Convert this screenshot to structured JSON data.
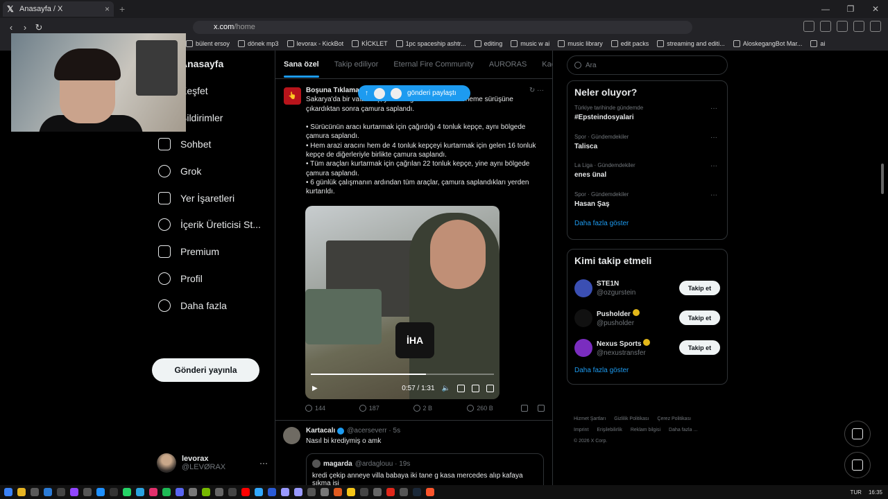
{
  "browser": {
    "tab_title": "Anasayfa / X",
    "url_host": "x.com",
    "url_path": "/home",
    "bookmarks": [
      "bülent ersoy",
      "dönek mp3",
      "levorax - KickBot",
      "KİCKLET",
      "1pc spaceship ashtr...",
      "editing",
      "music w ai",
      "music library",
      "edit packs",
      "streaming and editi...",
      "AloskegangBot Mar...",
      "ai"
    ]
  },
  "nav": {
    "items": [
      {
        "label": "Anasayfa",
        "icon": "home-icon"
      },
      {
        "label": "Keşfet",
        "icon": "search-icon"
      },
      {
        "label": "Bildirimler",
        "icon": "bell-icon"
      },
      {
        "label": "Sohbet",
        "icon": "mail-icon"
      },
      {
        "label": "Grok",
        "icon": "grok-icon"
      },
      {
        "label": "Yer İşaretleri",
        "icon": "bookmark-icon"
      },
      {
        "label": "İçerik Üreticisi St...",
        "icon": "creator-icon"
      },
      {
        "label": "Premium",
        "icon": "x-logo-icon"
      },
      {
        "label": "Profil",
        "icon": "person-icon"
      },
      {
        "label": "Daha fazla",
        "icon": "more-circle-icon"
      }
    ],
    "post_button": "Gönderi yayınla",
    "account": {
      "display_name": "levorax",
      "username": "@LEVØRAX"
    }
  },
  "feed": {
    "tabs": [
      "Sana özel",
      "Takip ediliyor",
      "Eternal Fire Community",
      "AURORAS",
      "Kachow"
    ],
    "share_pill": "gönderi paylaştı",
    "post1": {
      "author": "Boşuna Tıklama",
      "text": "Sakarya'da bir vatandaş, yeni aldığı arazi aracını deneme sürüşüne çıkardıktan sonra çamura saplandı.\n\n• Sürücünün aracı kurtarmak için çağırdığı 4 tonluk kepçe, aynı bölgede çamura saplandı.\n• Hem arazi aracını hem de 4 tonluk kepçeyi kurtarmak için gelen 16 tonluk kepçe de diğerleriyle birlikte çamura saplandı.\n• Tüm araçları kurtarmak için çağrılan 22 tonluk kepçe, yine aynı bölgede çamura saplandı.\n• 6 günlük çalışmanın ardından tüm araçlar, çamura saplandıkları yerden kurtarıldı.",
      "video_time": "0:57 / 1:31",
      "video_progress": 0.63,
      "mic_logo": "İHA",
      "replies": "144",
      "reposts": "187",
      "likes": "2 B",
      "views": "260 B"
    },
    "post2": {
      "author": "Kartacalı",
      "handle": "@acerseverr · 5s",
      "text": "Nasıl bi krediymiş o amk",
      "quote_author": "magarda",
      "quote_handle": "@ardaglouu · 19s",
      "quote_text": "kredi çekip anneye villa babaya iki tane g kasa mercedes alıp kafaya sıkma isi"
    }
  },
  "sidebar": {
    "search_placeholder": "Ara",
    "trends_title": "Neler oluyor?",
    "trends": [
      {
        "context": "Türkiye tarihinde gündemde",
        "topic": "#Epsteindosyalari"
      },
      {
        "context": "Spor · Gündemdekiler",
        "topic": "Talisca"
      },
      {
        "context": "La Liga · Gündemdekiler",
        "topic": "enes ünal"
      },
      {
        "context": "Spor · Gündemdekiler",
        "topic": "Hasan Şaş"
      }
    ],
    "show_more": "Daha fazla göster",
    "follow_title": "Kimi takip etmeli",
    "follow": [
      {
        "name": "STE1N",
        "handle": "@ozgurstein",
        "button": "Takip et",
        "verified": false,
        "avatar_color": "#3b4fb3"
      },
      {
        "name": "Pusholder",
        "handle": "@pusholder",
        "button": "Takip et",
        "verified": true,
        "avatar_color": "#111111"
      },
      {
        "name": "Nexus Sports",
        "handle": "@nexustransfer",
        "button": "Takip et",
        "verified": true,
        "avatar_color": "#7a2dbf"
      }
    ],
    "footer": [
      "Hizmet Şartları",
      "Gizlilik Politikası",
      "Çerez Politikası",
      "Imprint",
      "Erişilebilirlik",
      "Reklam bilgisi",
      "Daha fazla ...",
      "© 2026 X Corp."
    ]
  },
  "tray": {
    "lang": "TUR",
    "time": "16:35"
  }
}
